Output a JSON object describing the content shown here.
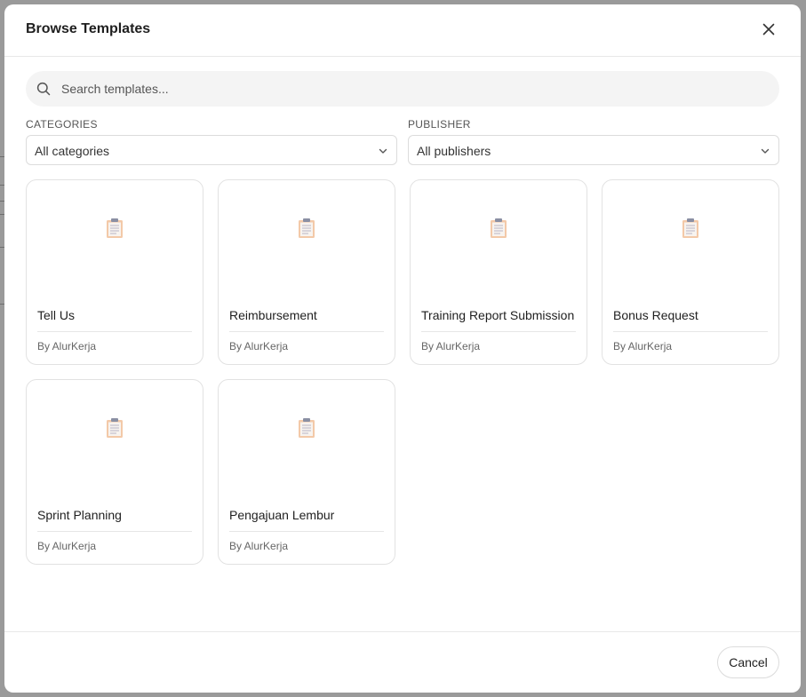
{
  "modal": {
    "title": "Browse Templates",
    "close_icon": "close-icon"
  },
  "search": {
    "placeholder": "Search templates...",
    "value": "",
    "icon": "search-icon"
  },
  "filters": {
    "categories": {
      "label": "CATEGORIES",
      "selected": "All categories",
      "icon": "chevron-down-icon"
    },
    "publisher": {
      "label": "PUBLISHER",
      "selected": "All publishers",
      "icon": "chevron-down-icon"
    }
  },
  "templates": [
    {
      "title": "Tell Us",
      "publisher": "By AlurKerja",
      "icon": "clipboard-icon"
    },
    {
      "title": "Reimbursement",
      "publisher": "By AlurKerja",
      "icon": "clipboard-icon"
    },
    {
      "title": "Training Report Submission",
      "publisher": "By AlurKerja",
      "icon": "clipboard-icon"
    },
    {
      "title": "Bonus Request",
      "publisher": "By AlurKerja",
      "icon": "clipboard-icon"
    },
    {
      "title": "Sprint Planning",
      "publisher": "By AlurKerja",
      "icon": "clipboard-icon"
    },
    {
      "title": "Pengajuan Lembur",
      "publisher": "By AlurKerja",
      "icon": "clipboard-icon"
    }
  ],
  "footer": {
    "cancel_label": "Cancel"
  },
  "colors": {
    "backdrop": "#9a9a9a",
    "surface": "#ffffff",
    "search_bg": "#f4f4f4",
    "border": "#e2e2e2",
    "clipboard_body": "#f3c9a8",
    "clipboard_clip": "#8a8fa3"
  }
}
